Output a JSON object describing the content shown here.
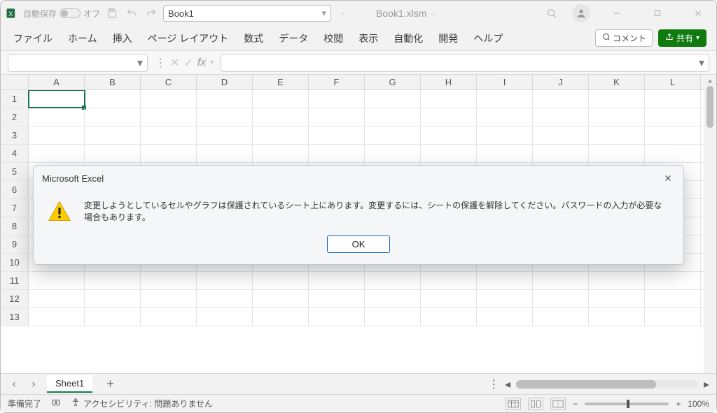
{
  "titlebar": {
    "autosave_label": "自動保存",
    "autosave_state": "オフ",
    "filename_box": "Book1",
    "doc_title": "Book1.xlsm"
  },
  "ribbon": {
    "tabs": [
      "ファイル",
      "ホーム",
      "挿入",
      "ページ レイアウト",
      "数式",
      "データ",
      "校閲",
      "表示",
      "自動化",
      "開発",
      "ヘルプ"
    ],
    "comments_label": "コメント",
    "share_label": "共有"
  },
  "formula_bar": {
    "name_box_value": "",
    "fx_label": "fx",
    "formula_value": ""
  },
  "grid": {
    "columns": [
      "A",
      "B",
      "C",
      "D",
      "E",
      "F",
      "G",
      "H",
      "I",
      "J",
      "K",
      "L"
    ],
    "row_count": 13,
    "active_cell": "A1"
  },
  "sheettabs": {
    "active_tab": "Sheet1"
  },
  "statusbar": {
    "ready": "準備完了",
    "accessibility": "アクセシビリティ: 問題ありません",
    "zoom": "100%"
  },
  "dialog": {
    "title": "Microsoft Excel",
    "message": "変更しようとしているセルやグラフは保護されているシート上にあります。変更するには、シートの保護を解除してください。パスワードの入力が必要な場合もあります。",
    "ok_label": "OK"
  },
  "colors": {
    "accent_green": "#18794e",
    "share_green": "#0f7b0f",
    "focus_blue": "#0a64c2"
  }
}
